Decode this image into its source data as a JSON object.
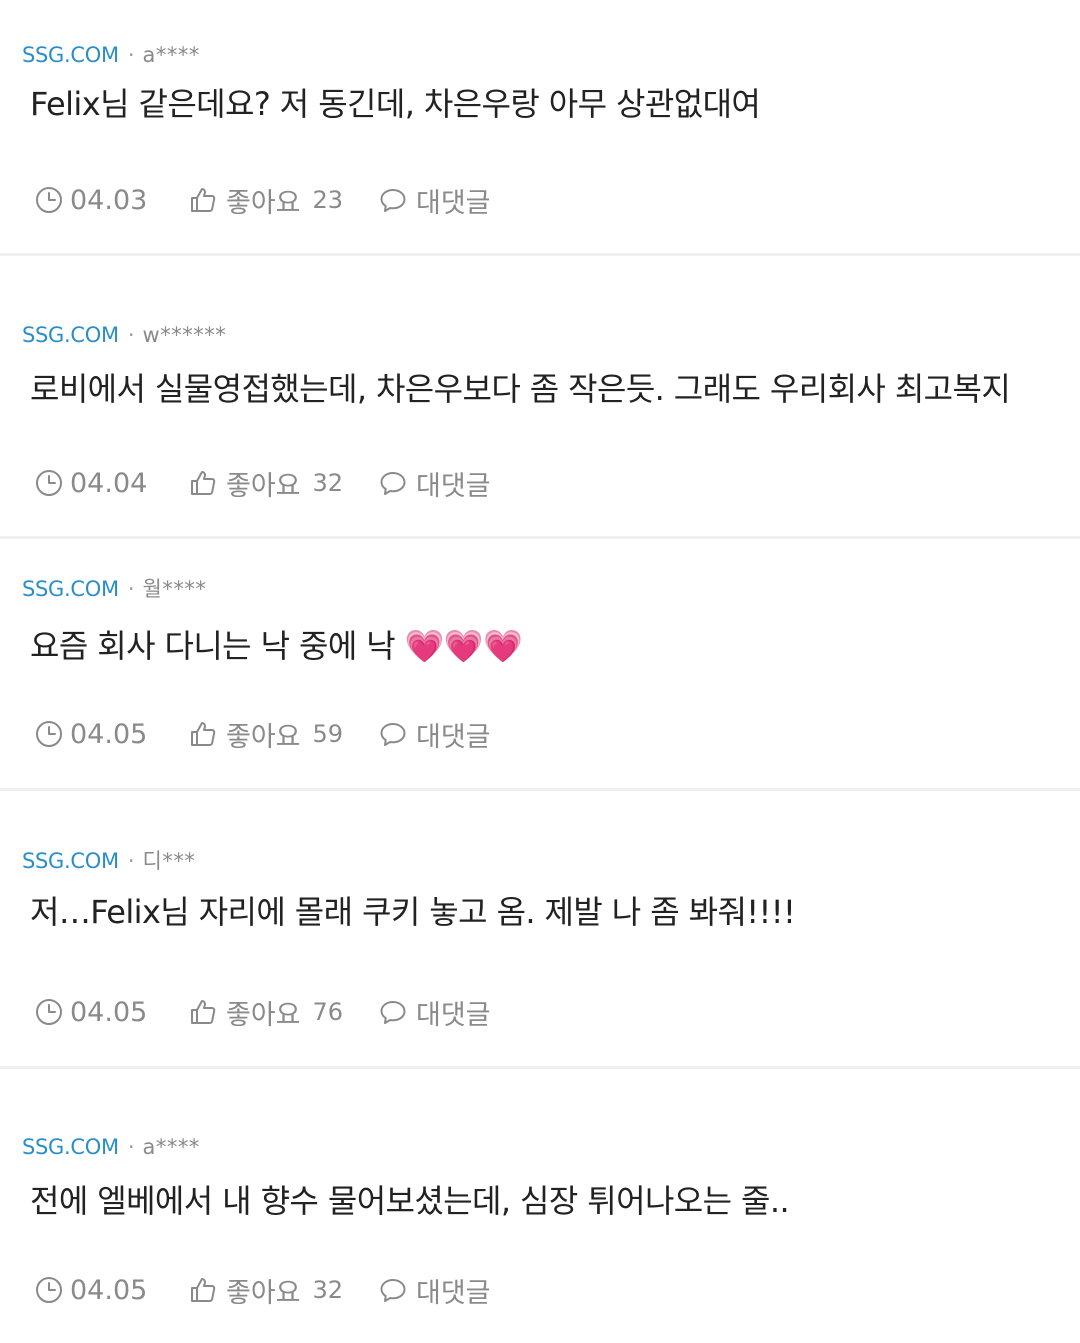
{
  "comments": [
    {
      "source": "SSG.COM",
      "separator": "·",
      "author": "a****",
      "text": "Felix님 같은데요? 저 동긴데, 차은우랑 아무 상관없대여",
      "emoji": "",
      "date": "04.03",
      "like_label": "좋아요",
      "like_count": "23",
      "reply_label": "대댓글"
    },
    {
      "source": "SSG.COM",
      "separator": "·",
      "author": "w******",
      "text": "로비에서 실물영접했는데, 차은우보다 좀 작은듯. 그래도 우리회사 최고복지",
      "emoji": "",
      "date": "04.04",
      "like_label": "좋아요",
      "like_count": "32",
      "reply_label": "대댓글"
    },
    {
      "source": "SSG.COM",
      "separator": "·",
      "author": "월****",
      "text": "요즘 회사 다니는 낙 중에 낙 ",
      "emoji": "💗💗💗",
      "date": "04.05",
      "like_label": "좋아요",
      "like_count": "59",
      "reply_label": "대댓글"
    },
    {
      "source": "SSG.COM",
      "separator": "·",
      "author": "디***",
      "text": "저…Felix님 자리에 몰래 쿠키 놓고 옴. 제발 나 좀 봐줘!!!!",
      "emoji": "",
      "date": "04.05",
      "like_label": "좋아요",
      "like_count": "76",
      "reply_label": "대댓글"
    },
    {
      "source": "SSG.COM",
      "separator": "·",
      "author": "a****",
      "text": "전에 엘베에서 내 향수 물어보셨는데, 심장 튀어나오는 줄..",
      "emoji": "",
      "date": "04.05",
      "like_label": "좋아요",
      "like_count": "32",
      "reply_label": "대댓글"
    }
  ],
  "icons": {
    "clock": "clock-icon",
    "like": "thumbs-up-icon",
    "reply": "speech-bubble-icon"
  },
  "colors": {
    "source": "#2a8fc9",
    "meta_gray": "#8a8a8a",
    "body_text": "#222222",
    "divider": "#efefef",
    "heart": "#ff5aa0"
  }
}
